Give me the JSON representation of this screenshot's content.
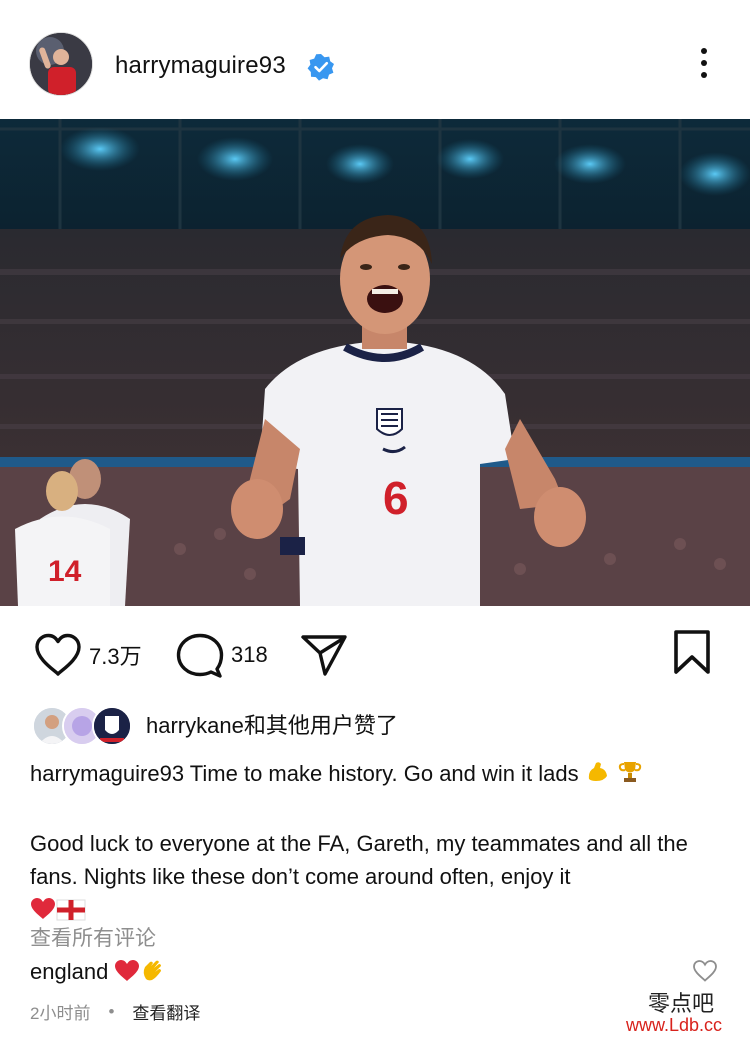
{
  "post": {
    "username": "harrymaguire93",
    "likes_count": "7.3万",
    "comments_count": "318",
    "liked_by_text": "harrykane和其他用户赞了",
    "caption_user": "harrymaguire93",
    "caption_line1": " Time to make history. Go and win it lads ",
    "caption_para2": "Good luck to everyone at the FA, Gareth, my teammates and all the fans. Nights like these don’t come around often, enjoy it",
    "view_comments": "查看所有评论",
    "comment_user": "england",
    "time_ago": "2小时前",
    "translate": "查看翻译",
    "jersey_number": "6",
    "teammate_number": "14"
  },
  "watermark": {
    "line1": "零点吧",
    "line2": "www.Ldb.cc"
  },
  "colors": {
    "verified_blue": "#3897f0",
    "heart_red": "#e0293b",
    "watermark_red": "#d8221c"
  },
  "icons": {
    "like": "heart-outline-icon",
    "comment": "speech-bubble-icon",
    "share": "paper-plane-icon",
    "save": "bookmark-icon",
    "more": "more-vertical-icon",
    "verified": "verified-badge-icon"
  }
}
